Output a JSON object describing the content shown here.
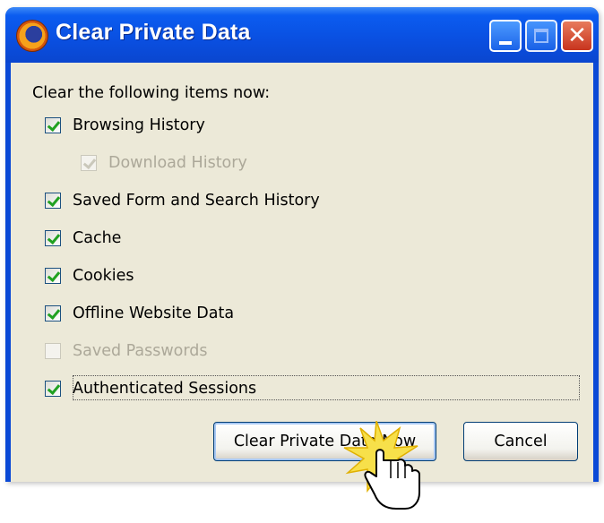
{
  "window": {
    "title": "Clear Private Data",
    "app_icon": "firefox-icon",
    "controls": [
      "minimize-icon",
      "maximize-icon",
      "close-icon"
    ],
    "close_glyph": "✕"
  },
  "content": {
    "heading": "Clear the following items now:",
    "items": [
      {
        "label": "Browsing History",
        "checked": true,
        "enabled": true
      },
      {
        "label": "Download History",
        "checked": true,
        "enabled": false
      },
      {
        "label": "Saved Form and Search History",
        "checked": true,
        "enabled": true
      },
      {
        "label": "Cache",
        "checked": true,
        "enabled": true
      },
      {
        "label": "Cookies",
        "checked": true,
        "enabled": true
      },
      {
        "label": "Offline Website Data",
        "checked": true,
        "enabled": true
      },
      {
        "label": "Saved Passwords",
        "checked": false,
        "enabled": false
      },
      {
        "label": "Authenticated Sessions",
        "checked": true,
        "enabled": true
      }
    ]
  },
  "buttons": {
    "clear_now": "Clear Private Data Now",
    "cancel": "Cancel"
  },
  "colors": {
    "titlebar": "#0a4fe0",
    "client_bg": "#ece9d8",
    "check": "#21a121",
    "disabled_text": "#aca899"
  }
}
